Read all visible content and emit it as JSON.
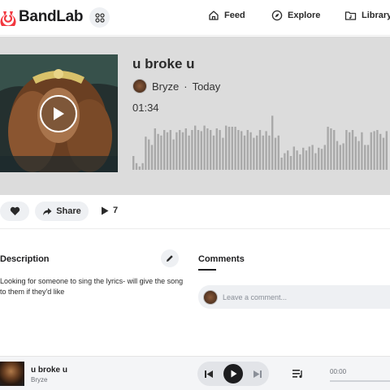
{
  "nav": {
    "brand": "BandLab",
    "items": [
      {
        "label": "Feed",
        "icon": "home-icon"
      },
      {
        "label": "Explore",
        "icon": "compass-icon"
      },
      {
        "label": "Library",
        "icon": "folder-music-icon"
      }
    ]
  },
  "track": {
    "title": "u broke u",
    "artist": "Bryze",
    "posted": "Today",
    "separator": "·",
    "duration": "01:34",
    "waveform": [
      0.25,
      0.12,
      0.06,
      0.12,
      0.6,
      0.55,
      0.45,
      0.75,
      0.65,
      0.62,
      0.72,
      0.68,
      0.72,
      0.55,
      0.68,
      0.72,
      0.68,
      0.75,
      0.62,
      0.72,
      0.8,
      0.72,
      0.7,
      0.8,
      0.75,
      0.72,
      0.62,
      0.75,
      0.72,
      0.58,
      0.8,
      0.78,
      0.78,
      0.78,
      0.72,
      0.7,
      0.62,
      0.72,
      0.68,
      0.58,
      0.62,
      0.72,
      0.62,
      0.7,
      0.62,
      0.98,
      0.58,
      0.62,
      0.22,
      0.3,
      0.35,
      0.25,
      0.42,
      0.35,
      0.28,
      0.4,
      0.35,
      0.42,
      0.45,
      0.3,
      0.4,
      0.38,
      0.45,
      0.78,
      0.75,
      0.72,
      0.52,
      0.45,
      0.48,
      0.72,
      0.68,
      0.72,
      0.6,
      0.52,
      0.68,
      0.45,
      0.45,
      0.68,
      0.7,
      0.72,
      0.65,
      0.58,
      0.7
    ]
  },
  "actions": {
    "share_label": "Share",
    "plays": "7"
  },
  "description": {
    "title": "Description",
    "text": "Looking for someone to sing the lyrics- will give the song to them if they'd like"
  },
  "comments": {
    "title": "Comments",
    "placeholder": "Leave a comment..."
  },
  "player": {
    "title": "u broke u",
    "artist": "Bryze",
    "time": "00:00",
    "progress": 0
  },
  "colors": {
    "brand": "#f2373f",
    "hero_bg": "#dcdcdc",
    "waveform": "#a9a9a9"
  }
}
